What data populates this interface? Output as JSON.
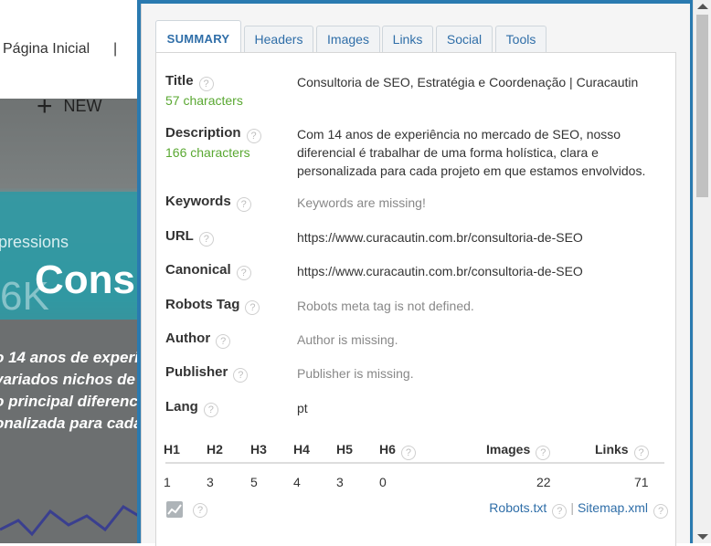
{
  "background_page": {
    "nav_link": "Página Inicial",
    "nav_separator": "|",
    "new_label": "NEW",
    "impressions_text": "pressions",
    "hero_title": "Cons",
    "stat_text": "6K",
    "paragraph_lines": [
      "o 14 anos de experi",
      " variados nichos de",
      "o principal diferenc",
      "onalizada para cada"
    ]
  },
  "tabs": [
    {
      "label": "SUMMARY",
      "active": true
    },
    {
      "label": "Headers",
      "active": false
    },
    {
      "label": "Images",
      "active": false
    },
    {
      "label": "Links",
      "active": false
    },
    {
      "label": "Social",
      "active": false
    },
    {
      "label": "Tools",
      "active": false
    }
  ],
  "summary": {
    "title": {
      "label": "Title",
      "chars": "57 characters",
      "value": "Consultoria de SEO, Estratégia e Coordenação | Curacautin"
    },
    "description": {
      "label": "Description",
      "chars": "166 characters",
      "value": "Com 14 anos de experiência no mercado de SEO, nosso diferencial é trabalhar de uma forma holística, clara e personalizada para cada projeto em que estamos envolvidos."
    },
    "keywords": {
      "label": "Keywords",
      "value": "Keywords are missing!"
    },
    "url": {
      "label": "URL",
      "value": "https://www.curacautin.com.br/consultoria-de-SEO"
    },
    "canonical": {
      "label": "Canonical",
      "value": "https://www.curacautin.com.br/consultoria-de-SEO"
    },
    "robots": {
      "label": "Robots Tag",
      "value": "Robots meta tag is not defined."
    },
    "author": {
      "label": "Author",
      "value": "Author is missing."
    },
    "publisher": {
      "label": "Publisher",
      "value": "Publisher is missing."
    },
    "lang": {
      "label": "Lang",
      "value": "pt"
    }
  },
  "headings": {
    "columns": [
      "H1",
      "H2",
      "H3",
      "H4",
      "H5",
      "H6",
      "Images",
      "Links"
    ],
    "values": [
      "1",
      "3",
      "5",
      "4",
      "3",
      "0",
      "22",
      "71"
    ]
  },
  "footer": {
    "robots_link": "Robots.txt",
    "separator": "|",
    "sitemap_link": "Sitemap.xml"
  },
  "help_glyph": "?",
  "colors": {
    "accent": "#2f6ea8",
    "chars_green": "#5aa832",
    "popup_border": "#2a7ab0"
  }
}
